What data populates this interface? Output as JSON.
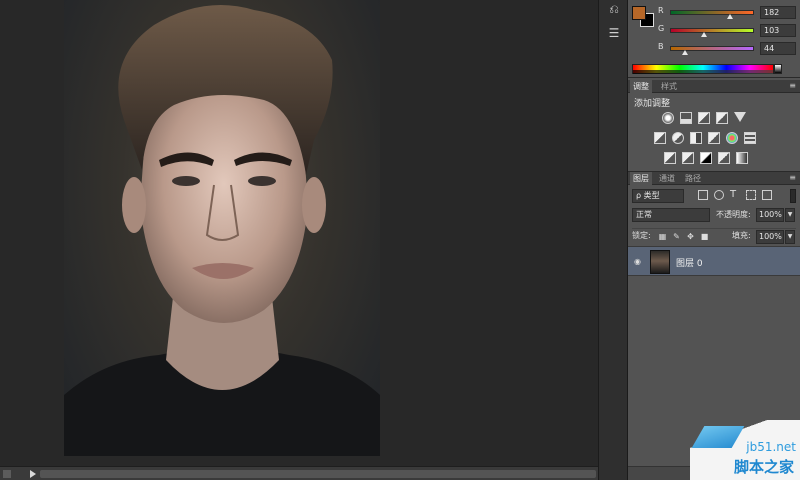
{
  "color_panel": {
    "foreground_color": "#b66728",
    "background_color": "#000000",
    "channels": [
      {
        "label": "R",
        "value": "182",
        "level": 0.714
      },
      {
        "label": "G",
        "value": "103",
        "level": 0.404
      },
      {
        "label": "B",
        "value": "44",
        "level": 0.173
      }
    ]
  },
  "adjustments": {
    "tabs": [
      "调整",
      "样式"
    ],
    "title": "添加调整"
  },
  "layers": {
    "tabs": [
      "图层",
      "通道",
      "路径"
    ],
    "kind_filter": "ρ 类型",
    "blend_mode": "正常",
    "opacity_label": "不透明度:",
    "opacity_value": "100%",
    "lock_label": "锁定:",
    "fill_label": "填充:",
    "fill_value": "100%",
    "items": [
      {
        "name": "图层 0",
        "visible": true,
        "selected": true
      }
    ]
  },
  "watermark": {
    "site": "jb51.net",
    "site_cn": "脚本之家"
  }
}
